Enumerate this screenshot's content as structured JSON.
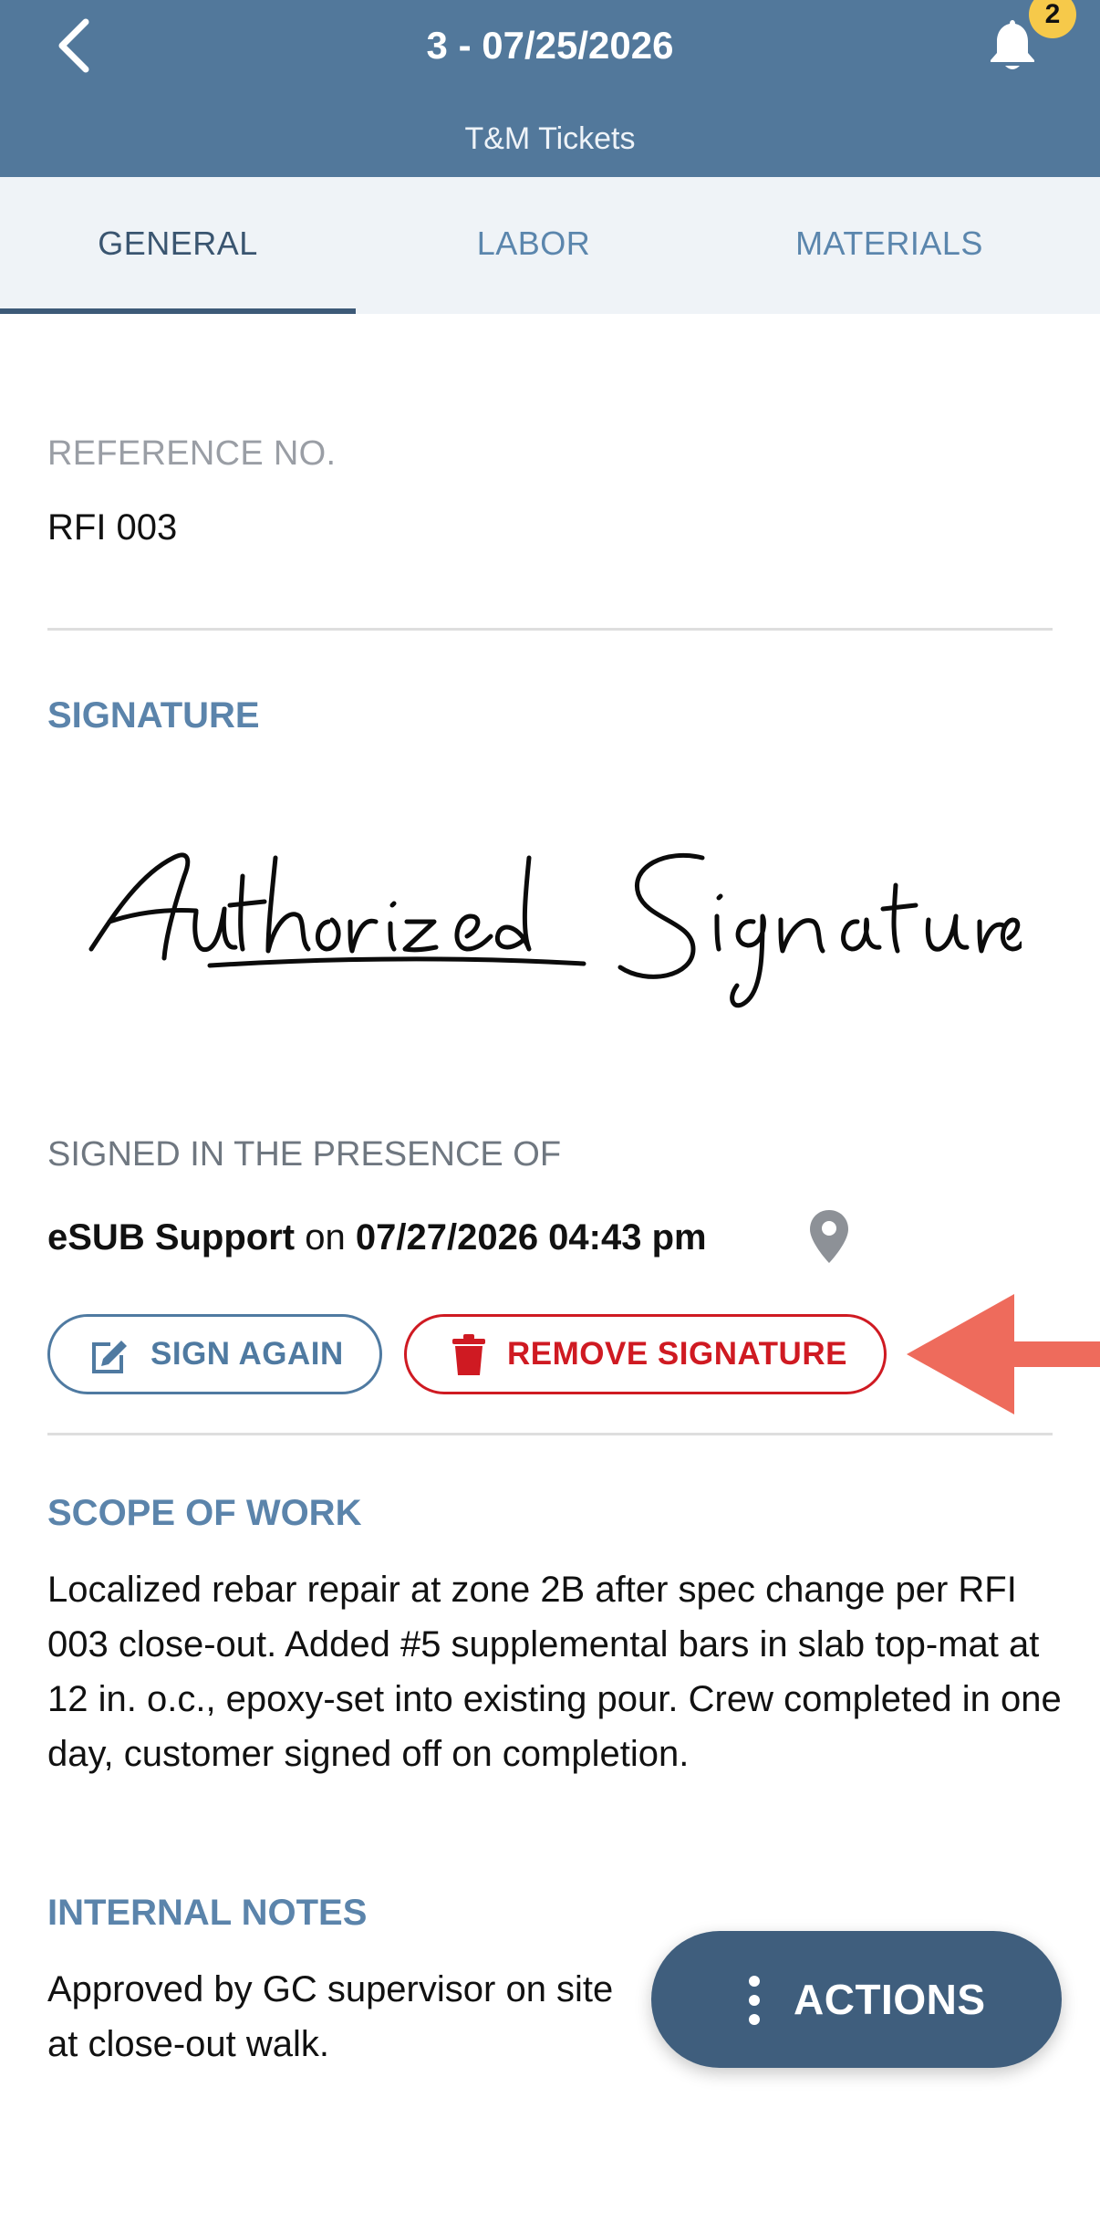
{
  "header": {
    "title": "3 - 07/25/2026",
    "subtitle": "T&M Tickets",
    "notification_count": "2"
  },
  "tabs": [
    {
      "label": "GENERAL",
      "active": true
    },
    {
      "label": "LABOR",
      "active": false
    },
    {
      "label": "MATERIALS",
      "active": false
    }
  ],
  "reference": {
    "label": "REFERENCE NO.",
    "value": "RFI 003"
  },
  "signature": {
    "label": "SIGNATURE",
    "image_text": "Authorized Signature",
    "presence_label": "SIGNED IN THE PRESENCE OF",
    "signer": "eSUB Support",
    "on_text": "on",
    "datetime": "07/27/2026 04:43 pm",
    "sign_again_label": "SIGN AGAIN",
    "remove_label": "REMOVE SIGNATURE"
  },
  "scope_of_work": {
    "label": "SCOPE OF WORK",
    "text": "Localized rebar repair at zone 2B after spec change per RFI 003 close-out. Added #5 supplemental bars in slab top-mat at 12 in. o.c., epoxy-set into existing pour. Crew completed in one day, customer signed off on completion."
  },
  "internal_notes": {
    "label": "INTERNAL NOTES",
    "text": "Approved by GC supervisor on site at close-out walk."
  },
  "actions": {
    "label": "ACTIONS"
  },
  "colors": {
    "header_bg": "#52789b",
    "accent_blue": "#5b84ab",
    "danger_red": "#cf1a22",
    "badge_yellow": "#f6c94a",
    "arrow_coral": "#ee6b5c",
    "fab_bg": "#3f5e7d"
  }
}
